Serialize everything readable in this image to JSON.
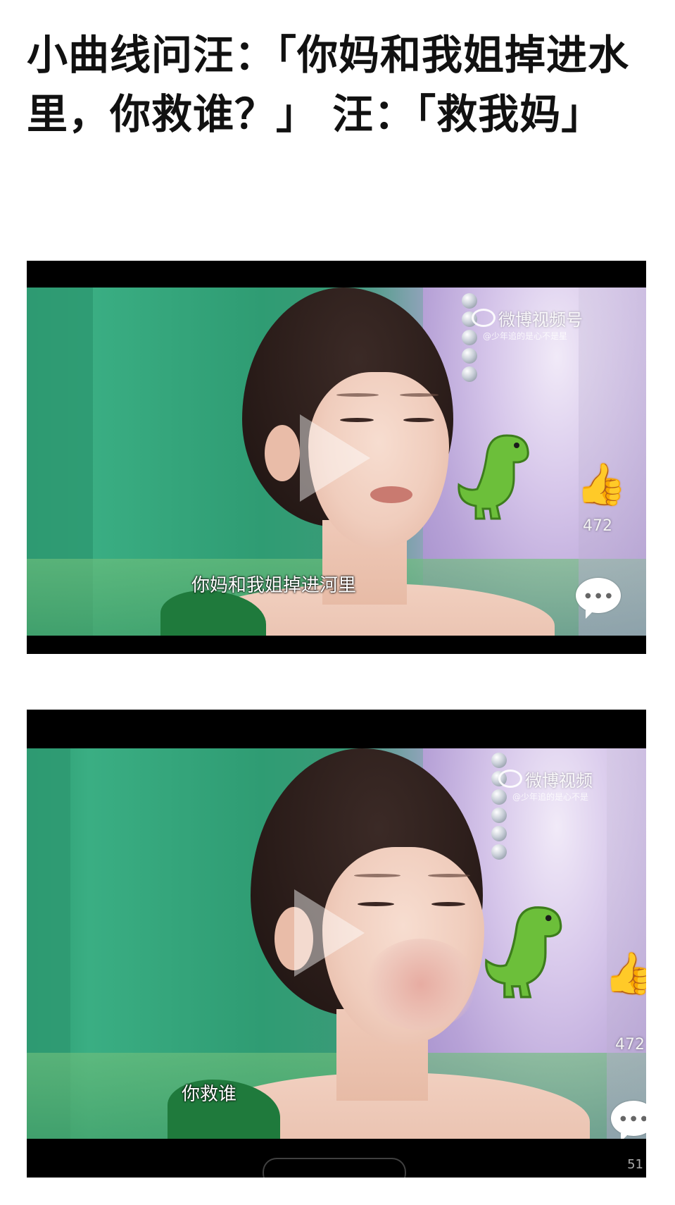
{
  "post": {
    "title": "小曲线问汪：「你妈和我姐掉进水里，你救谁？」 汪：「救我妈」"
  },
  "videos": [
    {
      "watermark": "微博视频号",
      "watermark_sub": "@少年追的是心不是星",
      "like_count": "472",
      "subtitle": "你妈和我姐掉进河里"
    },
    {
      "watermark": "微博视频",
      "watermark_sub": "@少年追的是心不是",
      "like_count": "472",
      "subtitle": "你救谁",
      "comment_count_partial": "51"
    }
  ],
  "colors": {
    "background_green": "#2f9c73",
    "dress_green": "#1f7a3c",
    "wall_lavender": "#c9b6e0",
    "dino_green": "#6cbf3a"
  }
}
